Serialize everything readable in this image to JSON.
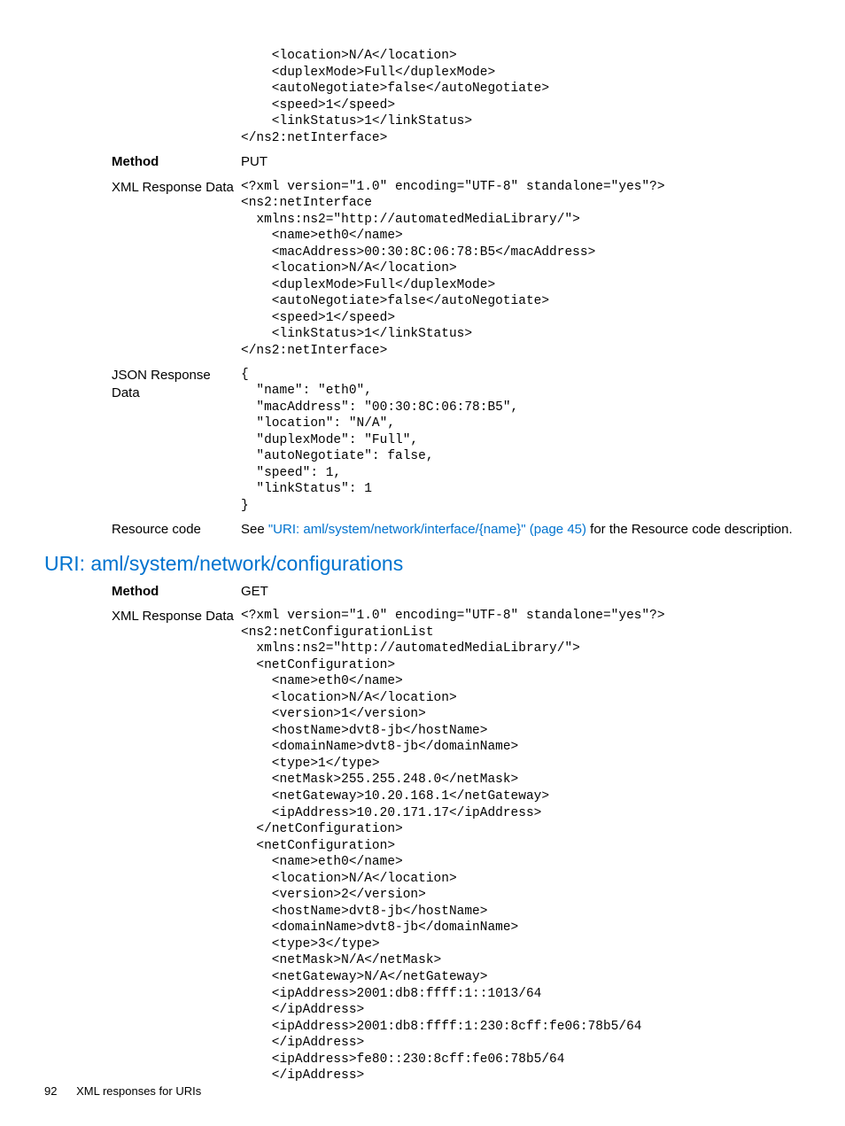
{
  "topCode": "    <location>N/A</location>\n    <duplexMode>Full</duplexMode>\n    <autoNegotiate>false</autoNegotiate>\n    <speed>1</speed>\n    <linkStatus>1</linkStatus>\n</ns2:netInterface>",
  "sec1": {
    "methodLabel": "Method",
    "methodValue": "PUT",
    "xmlLabel": "XML Response Data",
    "xmlCode": "<?xml version=\"1.0\" encoding=\"UTF-8\" standalone=\"yes\"?>\n<ns2:netInterface\n  xmlns:ns2=\"http://automatedMediaLibrary/\">\n    <name>eth0</name>\n    <macAddress>00:30:8C:06:78:B5</macAddress>\n    <location>N/A</location>\n    <duplexMode>Full</duplexMode>\n    <autoNegotiate>false</autoNegotiate>\n    <speed>1</speed>\n    <linkStatus>1</linkStatus>\n</ns2:netInterface>",
    "jsonLabel": "JSON Response Data",
    "jsonCode": "{\n  \"name\": \"eth0\",\n  \"macAddress\": \"00:30:8C:06:78:B5\",\n  \"location\": \"N/A\",\n  \"duplexMode\": \"Full\",\n  \"autoNegotiate\": false,\n  \"speed\": 1,\n  \"linkStatus\": 1\n}",
    "resourceLabel": "Resource code",
    "resourcePrefix": "See ",
    "resourceLink": "\"URI: aml/system/network/interface/{name}\" (page 45)",
    "resourceSuffix": " for the Resource code description."
  },
  "heading2": "URI: aml/system/network/configurations",
  "sec2": {
    "methodLabel": "Method",
    "methodValue": "GET",
    "xmlLabel": "XML Response Data",
    "xmlCode": "<?xml version=\"1.0\" encoding=\"UTF-8\" standalone=\"yes\"?>\n<ns2:netConfigurationList\n  xmlns:ns2=\"http://automatedMediaLibrary/\">\n  <netConfiguration>\n    <name>eth0</name>\n    <location>N/A</location>\n    <version>1</version>\n    <hostName>dvt8-jb</hostName>\n    <domainName>dvt8-jb</domainName>\n    <type>1</type>\n    <netMask>255.255.248.0</netMask>\n    <netGateway>10.20.168.1</netGateway>\n    <ipAddress>10.20.171.17</ipAddress>\n  </netConfiguration>\n  <netConfiguration>\n    <name>eth0</name>\n    <location>N/A</location>\n    <version>2</version>\n    <hostName>dvt8-jb</hostName>\n    <domainName>dvt8-jb</domainName>\n    <type>3</type>\n    <netMask>N/A</netMask>\n    <netGateway>N/A</netGateway>\n    <ipAddress>2001:db8:ffff:1::1013/64\n    </ipAddress>\n    <ipAddress>2001:db8:ffff:1:230:8cff:fe06:78b5/64\n    </ipAddress>\n    <ipAddress>fe80::230:8cff:fe06:78b5/64\n    </ipAddress>"
  },
  "footer": {
    "page": "92",
    "title": "XML responses for URIs"
  }
}
